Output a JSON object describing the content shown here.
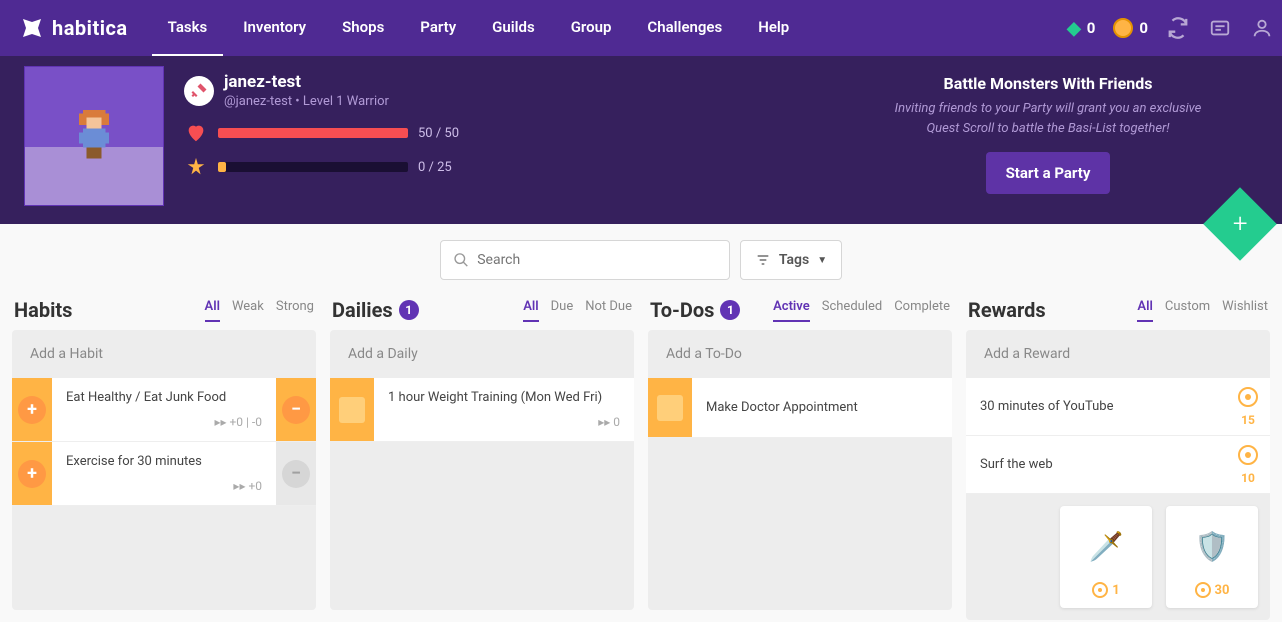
{
  "brand": "habitica",
  "nav": [
    "Tasks",
    "Inventory",
    "Shops",
    "Party",
    "Guilds",
    "Group",
    "Challenges",
    "Help"
  ],
  "nav_active": 0,
  "currency": {
    "gems": "0",
    "gold": "0"
  },
  "user": {
    "name": "janez-test",
    "subtitle": "@janez-test • Level 1 Warrior",
    "hp": {
      "value": 50,
      "max": 50,
      "label": "50 / 50",
      "color": "#f74e52"
    },
    "xp": {
      "value": 0,
      "max": 25,
      "label": "0 / 25",
      "color": "#ffb445"
    }
  },
  "party": {
    "title": "Battle Monsters With Friends",
    "desc": "Inviting friends to your Party will grant you an exclusive Quest Scroll to battle the Basi-List together!",
    "button": "Start a Party"
  },
  "search": {
    "placeholder": "Search"
  },
  "tags_label": "Tags",
  "columns": {
    "habits": {
      "title": "Habits",
      "filters": [
        "All",
        "Weak",
        "Strong"
      ],
      "active_filter": 0,
      "add_placeholder": "Add a Habit",
      "items": [
        {
          "text": "Eat Healthy / Eat Junk Food",
          "meta": "▸▸ +0 | -0",
          "plus": true,
          "minus": true
        },
        {
          "text": "Exercise for 30 minutes",
          "meta": "▸▸ +0",
          "plus": true,
          "minus": false
        }
      ]
    },
    "dailies": {
      "title": "Dailies",
      "count": "1",
      "filters": [
        "All",
        "Due",
        "Not Due"
      ],
      "active_filter": 0,
      "add_placeholder": "Add a Daily",
      "items": [
        {
          "text": "1 hour Weight Training (Mon Wed Fri)",
          "meta": "▸▸ 0"
        }
      ]
    },
    "todos": {
      "title": "To-Dos",
      "count": "1",
      "filters": [
        "Active",
        "Scheduled",
        "Complete"
      ],
      "active_filter": 0,
      "add_placeholder": "Add a To-Do",
      "items": [
        {
          "text": "Make Doctor Appointment"
        }
      ]
    },
    "rewards": {
      "title": "Rewards",
      "filters": [
        "All",
        "Custom",
        "Wishlist"
      ],
      "active_filter": 0,
      "add_placeholder": "Add a Reward",
      "items": [
        {
          "text": "30 minutes of YouTube",
          "cost": "15"
        },
        {
          "text": "Surf the web",
          "cost": "10"
        }
      ],
      "shop": [
        {
          "icon": "sword",
          "cost": "1"
        },
        {
          "icon": "armor",
          "cost": "30"
        }
      ]
    }
  }
}
